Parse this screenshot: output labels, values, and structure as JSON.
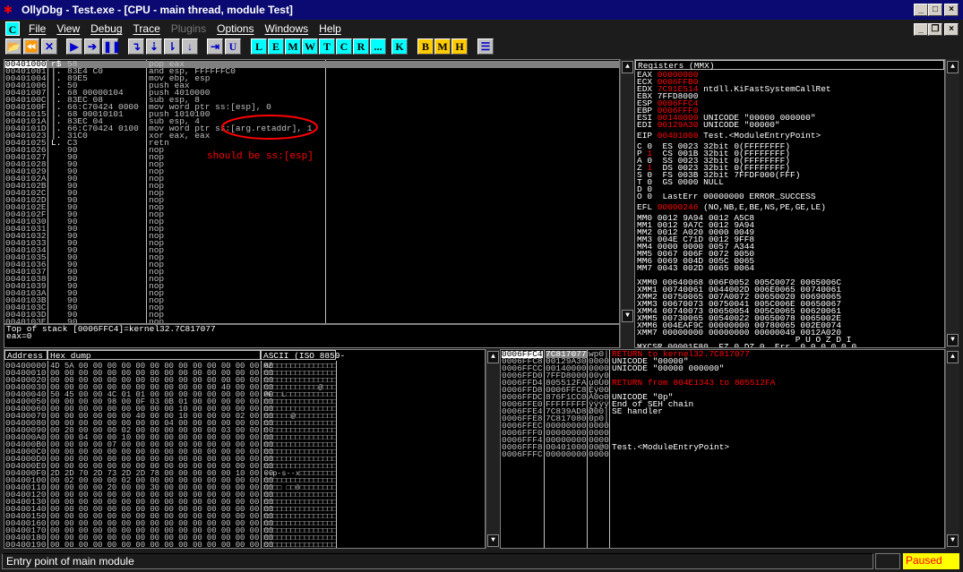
{
  "window": {
    "title": "OllyDbg - Test.exe - [CPU - main thread, module Test]",
    "buttons": [
      "_",
      "□",
      "×"
    ],
    "mdi_buttons": [
      "_",
      "❐",
      "×"
    ]
  },
  "menu": {
    "badge": "C",
    "items": [
      {
        "label": "File",
        "enabled": true
      },
      {
        "label": "View",
        "enabled": true
      },
      {
        "label": "Debug",
        "enabled": true
      },
      {
        "label": "Trace",
        "enabled": true
      },
      {
        "label": "Plugins",
        "enabled": false
      },
      {
        "label": "Options",
        "enabled": true
      },
      {
        "label": "Windows",
        "enabled": true
      },
      {
        "label": "Help",
        "enabled": true
      }
    ]
  },
  "toolbar": [
    {
      "name": "open",
      "glyph": "📂",
      "style": "ic"
    },
    {
      "name": "restart",
      "glyph": "⏪",
      "style": "ic"
    },
    {
      "name": "close",
      "glyph": "✕",
      "style": "ic"
    },
    {
      "name": "run",
      "glyph": "▶",
      "style": "ic"
    },
    {
      "name": "step",
      "glyph": "➔",
      "style": "ic"
    },
    {
      "name": "pause",
      "glyph": "❚❚",
      "style": "ic"
    },
    {
      "name": "step-into",
      "glyph": "↴",
      "style": "ic"
    },
    {
      "name": "step-over",
      "glyph": "⇣",
      "style": "ic"
    },
    {
      "name": "trace-into",
      "glyph": "⇂",
      "style": "ic"
    },
    {
      "name": "trace-over",
      "glyph": "↓",
      "style": "ic"
    },
    {
      "name": "execute-till-return",
      "glyph": "⇥",
      "style": "ic"
    },
    {
      "name": "execute-till-user",
      "glyph": "U",
      "style": "ic"
    },
    {
      "name": "log",
      "glyph": "L",
      "style": "cy"
    },
    {
      "name": "modules",
      "glyph": "E",
      "style": "cy"
    },
    {
      "name": "memory",
      "glyph": "M",
      "style": "cy"
    },
    {
      "name": "windows",
      "glyph": "W",
      "style": "cy"
    },
    {
      "name": "threads",
      "glyph": "T",
      "style": "cy"
    },
    {
      "name": "cpu",
      "glyph": "C",
      "style": "cy"
    },
    {
      "name": "references",
      "glyph": "R",
      "style": "cy"
    },
    {
      "name": "run-trace",
      "glyph": "...",
      "style": "cy"
    },
    {
      "name": "call-stack",
      "glyph": "K",
      "style": "cy"
    },
    {
      "name": "breakpoints",
      "glyph": "B",
      "style": "ye"
    },
    {
      "name": "memory-breakpoints",
      "glyph": "M",
      "style": "ye"
    },
    {
      "name": "hardware-breakpoints",
      "glyph": "H",
      "style": "ye"
    },
    {
      "name": "list",
      "glyph": "☰",
      "style": "ic"
    }
  ],
  "disasm": {
    "rows": [
      {
        "addr": "00401000",
        "mark": "r$",
        "hex": "58",
        "asm": "pop eax",
        "sel": true
      },
      {
        "addr": "00401001",
        "mark": "|.",
        "hex": "83E4 C0",
        "asm": "and esp, FFFFFFC0"
      },
      {
        "addr": "00401004",
        "mark": "|.",
        "hex": "89E5",
        "asm": "mov ebp, esp"
      },
      {
        "addr": "00401006",
        "mark": "|.",
        "hex": "50",
        "asm": "push eax"
      },
      {
        "addr": "00401007",
        "mark": "|.",
        "hex": "68 00000104",
        "asm": "push 4010000"
      },
      {
        "addr": "0040100C",
        "mark": "|.",
        "hex": "83EC 08",
        "asm": "sub esp, 8"
      },
      {
        "addr": "0040100F",
        "mark": "|.",
        "hex": "66:C70424 0000",
        "asm": "mov word ptr ss:[esp], 0"
      },
      {
        "addr": "00401015",
        "mark": "|.",
        "hex": "68 00010101",
        "asm": "push 1010100"
      },
      {
        "addr": "0040101A",
        "mark": "|.",
        "hex": "83EC 04",
        "asm": "sub esp, 4"
      },
      {
        "addr": "0040101D",
        "mark": "|.",
        "hex": "66:C70424 0100",
        "asm": "mov word ptr ss:[arg.retaddr], 1"
      },
      {
        "addr": "00401023",
        "mark": "|.",
        "hex": "31C0",
        "asm": "xor eax, eax"
      },
      {
        "addr": "00401025",
        "mark": "L.",
        "hex": "C3",
        "asm": "retn"
      },
      {
        "addr": "00401026",
        "mark": "",
        "hex": "90",
        "asm": "nop"
      },
      {
        "addr": "00401027",
        "mark": "",
        "hex": "90",
        "asm": "nop"
      },
      {
        "addr": "00401028",
        "mark": "",
        "hex": "90",
        "asm": "nop"
      },
      {
        "addr": "00401029",
        "mark": "",
        "hex": "90",
        "asm": "nop"
      },
      {
        "addr": "0040102A",
        "mark": "",
        "hex": "90",
        "asm": "nop"
      },
      {
        "addr": "0040102B",
        "mark": "",
        "hex": "90",
        "asm": "nop"
      },
      {
        "addr": "0040102C",
        "mark": "",
        "hex": "90",
        "asm": "nop"
      },
      {
        "addr": "0040102D",
        "mark": "",
        "hex": "90",
        "asm": "nop"
      },
      {
        "addr": "0040102E",
        "mark": "",
        "hex": "90",
        "asm": "nop"
      },
      {
        "addr": "0040102F",
        "mark": "",
        "hex": "90",
        "asm": "nop"
      },
      {
        "addr": "00401030",
        "mark": "",
        "hex": "90",
        "asm": "nop"
      },
      {
        "addr": "00401031",
        "mark": "",
        "hex": "90",
        "asm": "nop"
      },
      {
        "addr": "00401032",
        "mark": "",
        "hex": "90",
        "asm": "nop"
      },
      {
        "addr": "00401033",
        "mark": "",
        "hex": "90",
        "asm": "nop"
      },
      {
        "addr": "00401034",
        "mark": "",
        "hex": "90",
        "asm": "nop"
      },
      {
        "addr": "00401035",
        "mark": "",
        "hex": "90",
        "asm": "nop"
      },
      {
        "addr": "00401036",
        "mark": "",
        "hex": "90",
        "asm": "nop"
      },
      {
        "addr": "00401037",
        "mark": "",
        "hex": "90",
        "asm": "nop"
      },
      {
        "addr": "00401038",
        "mark": "",
        "hex": "90",
        "asm": "nop"
      },
      {
        "addr": "00401039",
        "mark": "",
        "hex": "90",
        "asm": "nop"
      },
      {
        "addr": "0040103A",
        "mark": "",
        "hex": "90",
        "asm": "nop"
      },
      {
        "addr": "0040103B",
        "mark": "",
        "hex": "90",
        "asm": "nop"
      },
      {
        "addr": "0040103C",
        "mark": "",
        "hex": "90",
        "asm": "nop"
      },
      {
        "addr": "0040103D",
        "mark": "",
        "hex": "90",
        "asm": "nop"
      },
      {
        "addr": "0040103E",
        "mark": "",
        "hex": "90",
        "asm": "nop"
      }
    ],
    "annotation": "should be ss:[esp]"
  },
  "info": {
    "lines": [
      "Top of stack [0006FFC4]=kernel32.7C817077",
      "eax=0"
    ]
  },
  "registers": {
    "title": "Registers (MMX)",
    "gp": [
      {
        "name": "EAX",
        "value": "00000000",
        "changed": true,
        "comment": ""
      },
      {
        "name": "ECX",
        "value": "0006FFB0",
        "changed": true,
        "comment": ""
      },
      {
        "name": "EDX",
        "value": "7C91E514",
        "changed": true,
        "comment": "ntdll.KiFastSystemCallRet"
      },
      {
        "name": "EBX",
        "value": "7FFD8000",
        "changed": false,
        "comment": ""
      },
      {
        "name": "ESP",
        "value": "0006FFC4",
        "changed": true,
        "comment": ""
      },
      {
        "name": "EBP",
        "value": "0006FFF0",
        "changed": true,
        "comment": ""
      },
      {
        "name": "ESI",
        "value": "00140000",
        "changed": true,
        "comment": "UNICODE \"00000 000000\""
      },
      {
        "name": "EDI",
        "value": "00129A30",
        "changed": true,
        "comment": "UNICODE \"00000\""
      }
    ],
    "eip": {
      "name": "EIP",
      "value": "00401000",
      "comment": "Test.<ModuleEntryPoint>"
    },
    "flags": [
      {
        "f": "C",
        "v": "0",
        "changed": false,
        "rest": "ES 0023 32bit 0(FFFFFFFF)"
      },
      {
        "f": "P",
        "v": "1",
        "changed": true,
        "rest": "CS 001B 32bit 0(FFFFFFFF)"
      },
      {
        "f": "A",
        "v": "0",
        "changed": false,
        "rest": "SS 0023 32bit 0(FFFFFFFF)"
      },
      {
        "f": "Z",
        "v": "1",
        "changed": true,
        "rest": "DS 0023 32bit 0(FFFFFFFF)"
      },
      {
        "f": "S",
        "v": "0",
        "changed": false,
        "rest": "FS 003B 32bit 7FFDF000(FFF)"
      },
      {
        "f": "T",
        "v": "0",
        "changed": false,
        "rest": "GS 0000 NULL"
      },
      {
        "f": "D",
        "v": "0",
        "changed": false,
        "rest": ""
      },
      {
        "f": "O",
        "v": "0",
        "changed": false,
        "rest": "LastErr 00000000 ERROR_SUCCESS"
      }
    ],
    "efl": {
      "name": "EFL",
      "value": "00000246",
      "comment": "(NO,NB,E,BE,NS,PE,GE,LE)"
    },
    "mmx": [
      "MM0 0012 9A94 0012 A5C8",
      "MM1 0012 9A7C 0012 9A94",
      "MM2 0012 A020 0000 0049",
      "MM3 004E C71D 0012 9FF8",
      "MM4 0000 0000 0057 A344",
      "MM5 0067 006F 0072 0050",
      "MM6 0069 004D 005C 0065",
      "MM7 0043 002D 0065 0064"
    ],
    "xmm": [
      "XMM0 00640068 006F0052 005C0072 0065006C",
      "XMM1 00740061 0044002D 006E0065 00740061",
      "XMM2 00750065 007A0072 00650020 00690065",
      "XMM3 00670073 00750041 005C006E 00650067",
      "XMM4 00740073 00650054 005C0065 00620061",
      "XMM5 00730065 00540022 00650078 0065002E",
      "XMM6 004EAF9C 00000000 00780065 002E0074",
      "XMM7 00000000 00000000 00000049 0012A020"
    ],
    "mxcsr": [
      "                               P U O Z D I",
      "MXCSR 00001F80  FZ 0 DZ 0  Err  0 0 0 0 0 0"
    ]
  },
  "dump": {
    "headers": {
      "address": "Address",
      "hex": "Hex dump",
      "ascii": "ASCII (ISO 8859-"
    },
    "rows": [
      {
        "a": "00400000",
        "h": "4D 5A 00 00 00 00 00 00 00 00 00 00 00 00 00 00",
        "s": "MZ□□□□□□□□□□□□□□"
      },
      {
        "a": "00400010",
        "h": "00 00 00 00 00 00 00 00 00 00 00 00 00 00 00 00",
        "s": "□□□□□□□□□□□□□□□□"
      },
      {
        "a": "00400020",
        "h": "00 00 00 00 00 00 00 00 00 00 00 00 00 00 00 00",
        "s": "□□□□□□□□□□□□□□□□"
      },
      {
        "a": "00400030",
        "h": "00 00 00 00 00 00 00 00 00 00 00 00 40 00 00 00",
        "s": "□□□□□□□□□□□□@□□□"
      },
      {
        "a": "00400040",
        "h": "50 45 00 00 4C 01 01 00 00 00 00 00 00 00 00 00",
        "s": "PE□□L□□□□□□□□□□□"
      },
      {
        "a": "00400050",
        "h": "00 00 00 00 98 00 0F 03 0B 01 00 00 00 00 00 00",
        "s": "□□□□□□□□□□□□□□□□"
      },
      {
        "a": "00400060",
        "h": "00 00 00 00 00 00 00 00 00 10 00 00 00 00 00 00",
        "s": "□□□□□□□□□□□□□□□□"
      },
      {
        "a": "00400070",
        "h": "00 00 00 00 00 00 40 00 00 10 00 00 00 02 00 00",
        "s": "□□□□□□@□□□□□□□□□"
      },
      {
        "a": "00400080",
        "h": "00 00 00 00 00 00 00 00 04 00 00 00 00 00 00 00",
        "s": "□□□□□□□□□□□□□□□□"
      },
      {
        "a": "00400090",
        "h": "00 20 00 00 00 02 00 00 00 00 00 00 03 00 00 00",
        "s": "□ □□□□□□□□□□□□□□"
      },
      {
        "a": "004000A0",
        "h": "00 00 04 00 00 10 00 00 00 00 00 00 00 00 00 00",
        "s": "□□□□□□□□□□□□□□□□"
      },
      {
        "a": "004000B0",
        "h": "00 00 00 00 07 00 00 00 00 00 00 00 00 00 00 00",
        "s": "□□□□□□□□□□□□□□□□"
      },
      {
        "a": "004000C0",
        "h": "00 00 00 00 00 00 00 00 00 00 00 00 00 00 00 00",
        "s": "□□□□□□□□□□□□□□□□"
      },
      {
        "a": "004000D0",
        "h": "00 00 00 00 00 00 00 00 00 00 00 00 00 00 00 00",
        "s": "□□□□□□□□□□□□□□□□"
      },
      {
        "a": "004000E0",
        "h": "00 00 00 00 00 00 00 00 00 00 00 00 00 00 00 00",
        "s": "□□□□□□□□□□□□□□□□"
      },
      {
        "a": "004000F0",
        "h": "2D 2D 70 2D 73 2D 2D 78 00 00 00 00 00 10 00 00",
        "s": "--p-s--x□□□□□□□□"
      },
      {
        "a": "00400100",
        "h": "00 02 00 00 00 02 00 00 00 00 00 00 00 00 00 00",
        "s": "□□□□□□□□□□□□□□□□"
      },
      {
        "a": "00400110",
        "h": "00 00 00 00 20 00 00 30 00 00 00 00 00 00 00 00",
        "s": "□□□□ □□0□□□□□□□□"
      },
      {
        "a": "00400120",
        "h": "00 00 00 00 00 00 00 00 00 00 00 00 00 00 00 00",
        "s": "□□□□□□□□□□□□□□□□"
      },
      {
        "a": "00400130",
        "h": "00 00 00 00 00 00 00 00 00 00 00 00 00 00 00 00",
        "s": "□□□□□□□□□□□□□□□□"
      },
      {
        "a": "00400140",
        "h": "00 00 00 00 00 00 00 00 00 00 00 00 00 00 00 00",
        "s": "□□□□□□□□□□□□□□□□"
      },
      {
        "a": "00400150",
        "h": "00 00 00 00 00 00 00 00 00 00 00 00 00 00 00 00",
        "s": "□□□□□□□□□□□□□□□□"
      },
      {
        "a": "00400160",
        "h": "00 00 00 00 00 00 00 00 00 00 00 00 00 00 00 00",
        "s": "□□□□□□□□□□□□□□□□"
      },
      {
        "a": "00400170",
        "h": "00 00 00 00 00 00 00 00 00 00 00 00 00 00 00 00",
        "s": "□□□□□□□□□□□□□□□□"
      },
      {
        "a": "00400180",
        "h": "00 00 00 00 00 00 00 00 00 00 00 00 00 00 00 00",
        "s": "□□□□□□□□□□□□□□□□"
      },
      {
        "a": "00400190",
        "h": "00 00 00 00 00 00 00 00 00 00 00 00 00 00 00 00",
        "s": "□□□□□□□□□□□□□□□□"
      }
    ]
  },
  "stack": {
    "rows": [
      {
        "a": "0006FFC4",
        "v": "7C817077",
        "s": "wp0|",
        "c": "RETURN to kernel32.7C817077",
        "red": true,
        "sel": true
      },
      {
        "a": "0006FFC8",
        "v": "00129A30",
        "s": "0000",
        "c": "UNICODE \"00000\""
      },
      {
        "a": "0006FFCC",
        "v": "00140000",
        "s": "0000",
        "c": "UNICODE \"00000 000000\""
      },
      {
        "a": "0006FFD0",
        "v": "7FFD8000",
        "s": "00y0",
        "c": ""
      },
      {
        "a": "0006FFD4",
        "v": "805512FA",
        "s": "ú0U0",
        "c": "RETURN from 804E1343 to 805512FA",
        "red": true
      },
      {
        "a": "0006FFD8",
        "v": "0006FFC8",
        "s": "Èÿ00",
        "c": ""
      },
      {
        "a": "0006FFDC",
        "v": "876F1CC0",
        "s": "À0o0",
        "c": "UNICODE \"0p\""
      },
      {
        "a": "0006FFE0",
        "v": "FFFFFFFF",
        "s": "ÿÿÿÿ",
        "c": "End of SEH chain"
      },
      {
        "a": "0006FFE4",
        "v": "7C839AD8",
        "s": "Ø00|",
        "c": "SE handler"
      },
      {
        "a": "0006FFE8",
        "v": "7C817080",
        "s": "0p0|",
        "c": ""
      },
      {
        "a": "0006FFEC",
        "v": "00000000",
        "s": "0000",
        "c": ""
      },
      {
        "a": "0006FFF0",
        "v": "00000000",
        "s": "0000",
        "c": ""
      },
      {
        "a": "0006FFF4",
        "v": "00000000",
        "s": "0000",
        "c": ""
      },
      {
        "a": "0006FFF8",
        "v": "00401000",
        "s": "00@0",
        "c": "Test.<ModuleEntryPoint>"
      },
      {
        "a": "0006FFFC",
        "v": "00000000",
        "s": "0000",
        "c": ""
      }
    ]
  },
  "status": {
    "message": "Entry point of main module",
    "state": "Paused"
  },
  "colors": {
    "title": "#0a0a72",
    "changed": "#ff0000",
    "paused_bg": "#ffff00"
  }
}
